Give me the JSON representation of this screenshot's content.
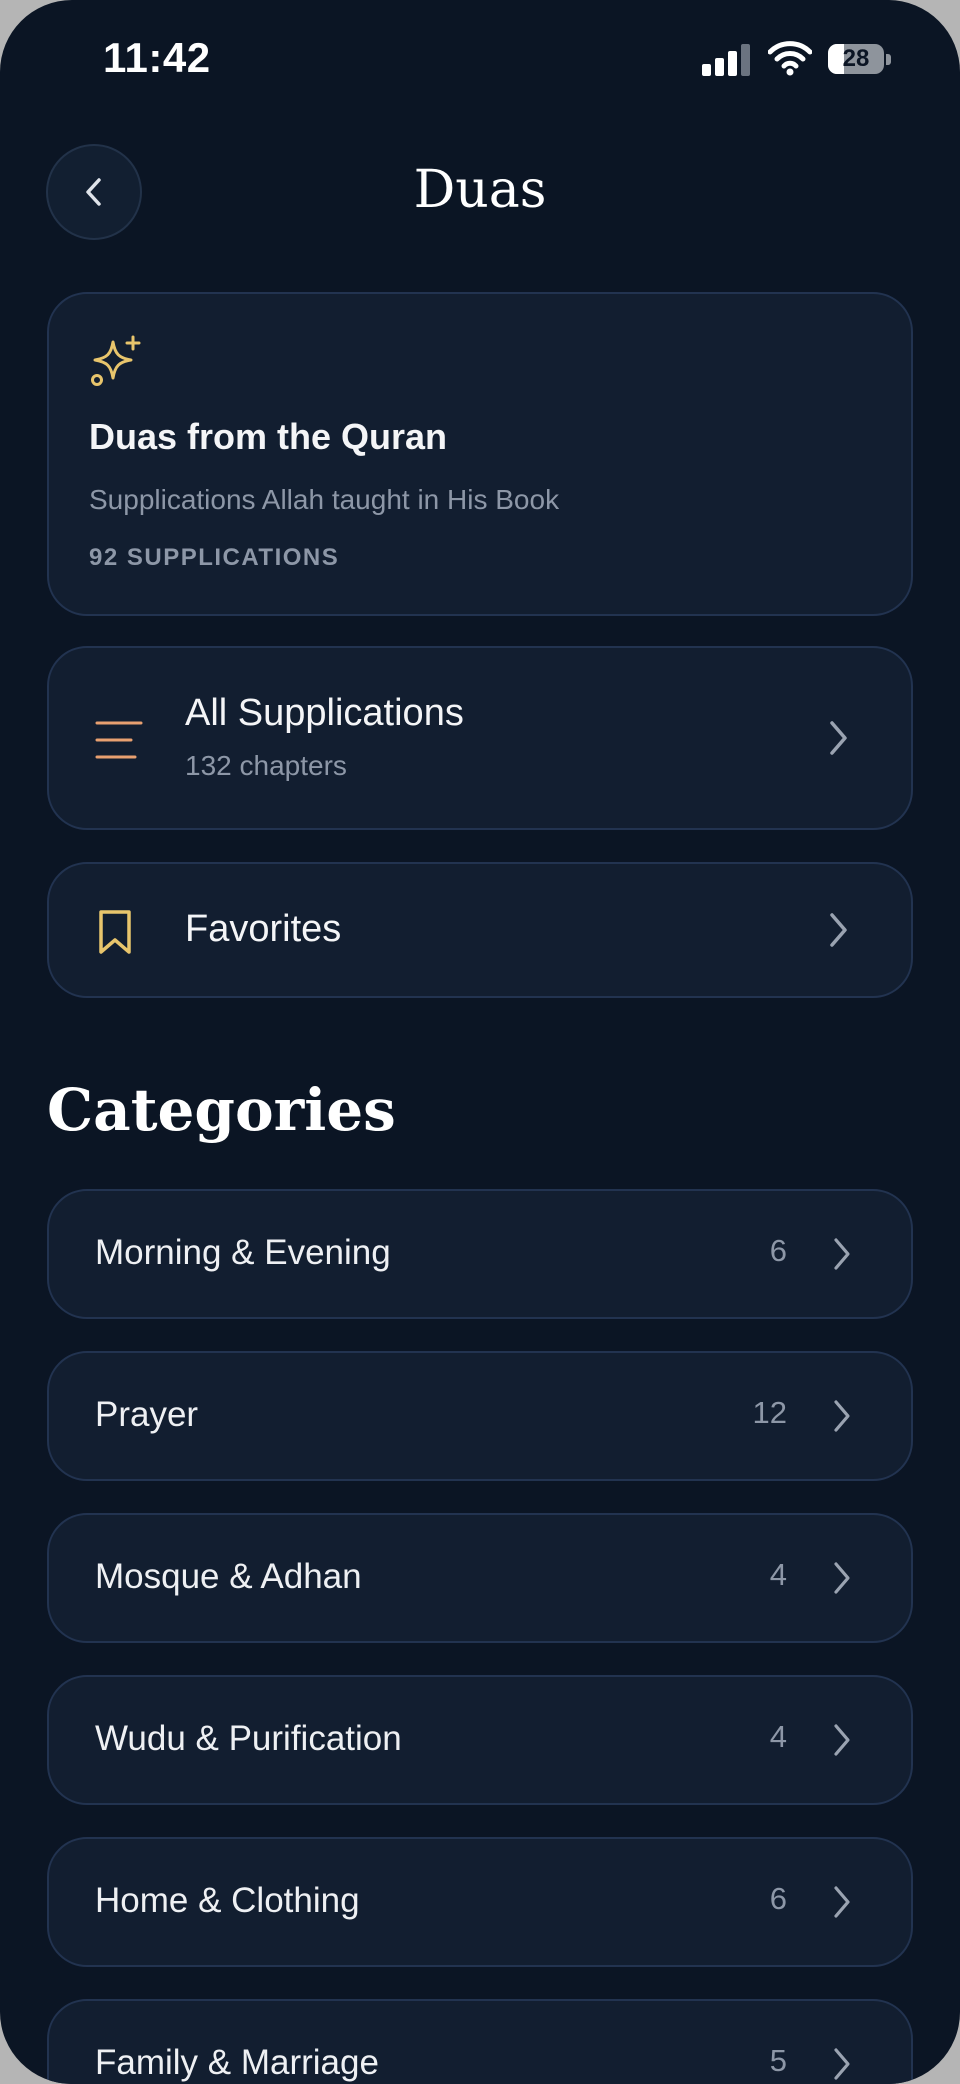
{
  "status_bar": {
    "time": "11:42",
    "battery": "28",
    "battery_level": 0.28
  },
  "header": {
    "title": "Duas",
    "back_icon": "chevron-left-icon"
  },
  "featured": {
    "icon": "sparkle-icon",
    "title": "Duas from the Quran",
    "subtitle": "Supplications Allah taught in His Book",
    "count": "92 SUPPLICATIONS"
  },
  "all_supplications": {
    "icon": "list-lines-icon",
    "label": "All Supplications",
    "sub": "132 chapters"
  },
  "favorites": {
    "icon": "bookmark-icon",
    "label": "Favorites"
  },
  "categories_title": "Categories",
  "categories": [
    {
      "label": "Morning & Evening",
      "count": "6"
    },
    {
      "label": "Prayer",
      "count": "12"
    },
    {
      "label": "Mosque & Adhan",
      "count": "4"
    },
    {
      "label": "Wudu & Purification",
      "count": "4"
    },
    {
      "label": "Home & Clothing",
      "count": "6"
    },
    {
      "label": "Family & Marriage",
      "count": "5"
    }
  ],
  "colors": {
    "background": "#0b1524",
    "card": "#121e30",
    "accent_gold": "#e8c56c",
    "accent_orange": "#e8a070",
    "muted_text": "#8d97a7"
  }
}
